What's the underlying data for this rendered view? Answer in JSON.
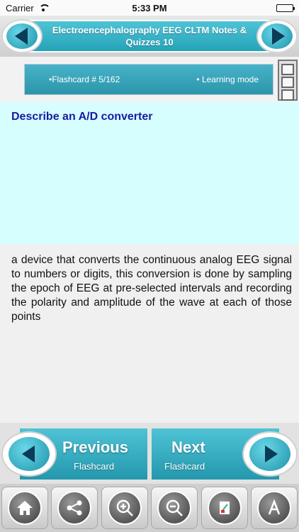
{
  "status_bar": {
    "carrier": "Carrier",
    "time": "5:33 PM"
  },
  "header": {
    "title": "Electroencephalography EEG CLTM Notes & Quizzes 10"
  },
  "info": {
    "flashcard": "•Flashcard #  5/162",
    "mode": "• Learning mode"
  },
  "question": "Describe an A/D converter",
  "answer": "a device that converts the continuous analog EEG signal to numbers or digits, this conversion is done by sampling the epoch of EEG at pre-selected intervals and recording the polarity and amplitude of the wave at each of those points",
  "nav": {
    "prev_big": "Previous",
    "prev_small": "Flashcard",
    "next_big": "Next",
    "next_small": "Flashcard"
  },
  "toolbar_icons": [
    "home-icon",
    "share-icon",
    "zoom-in-icon",
    "zoom-out-icon",
    "edit-icon",
    "text-size-icon"
  ],
  "colors": {
    "accent": "#2ea7bd",
    "question_bg": "#d6feff",
    "question_text": "#1a1aa0"
  }
}
